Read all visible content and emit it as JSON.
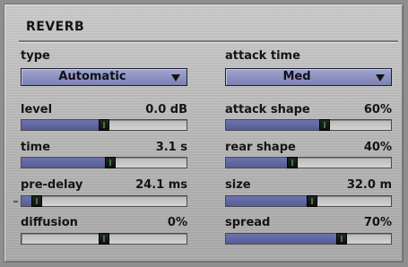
{
  "panel": {
    "title": "REVERB"
  },
  "left": {
    "type": {
      "label": "type",
      "value": "Automatic"
    },
    "level": {
      "label": "level",
      "value": "0.0 dB",
      "fraction": 0.5
    },
    "time": {
      "label": "time",
      "value": "3.1 s",
      "fraction": 0.54
    },
    "pre_delay": {
      "label": "pre-delay",
      "value": "24.1 ms",
      "fraction": 0.09
    },
    "diffusion": {
      "label": "diffusion",
      "value": "0%",
      "fraction": 0.5
    }
  },
  "right": {
    "attack_time": {
      "label": "attack  time",
      "value": "Med"
    },
    "attack_shape": {
      "label": "attack shape",
      "value": "60%",
      "fraction": 0.6
    },
    "rear_shape": {
      "label": "rear  shape",
      "value": "40%",
      "fraction": 0.4
    },
    "size": {
      "label": "size",
      "value": "32.0 m",
      "fraction": 0.52
    },
    "spread": {
      "label": "spread",
      "value": "70%",
      "fraction": 0.7
    }
  },
  "colors": {
    "accent": "#555c98",
    "dropdown": "#8d92c1",
    "thumb": "#141414"
  }
}
